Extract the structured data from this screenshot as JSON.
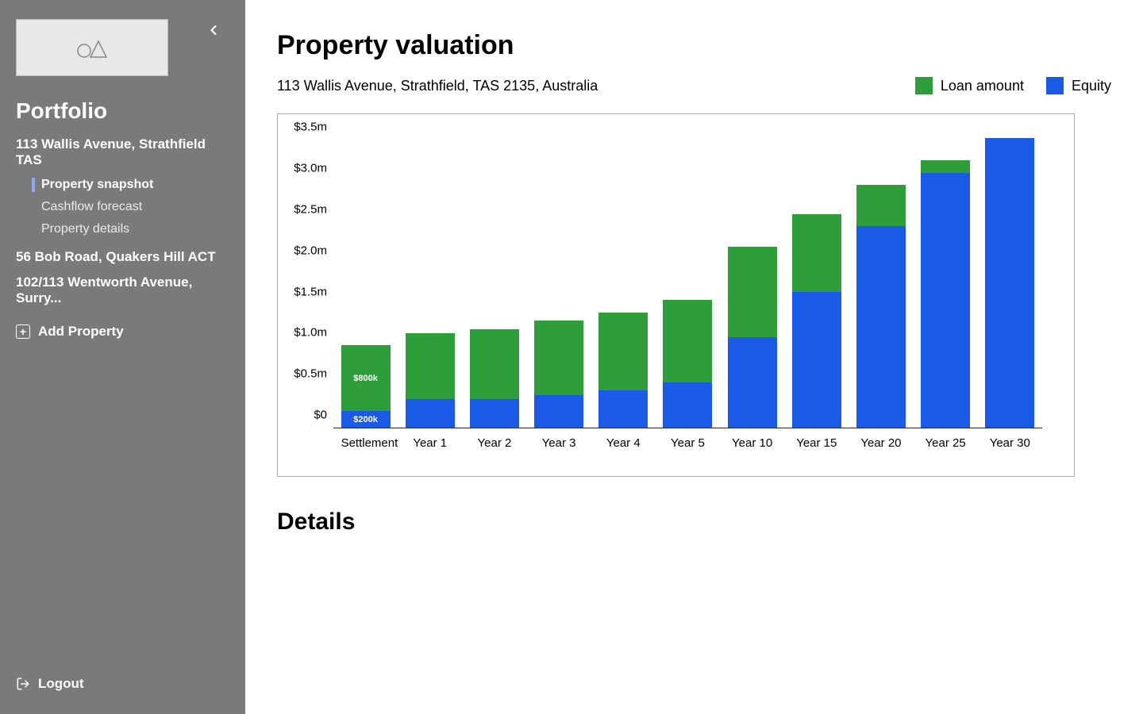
{
  "sidebar": {
    "section_title": "Portfolio",
    "properties": [
      {
        "label": "113 Wallis Avenue, Strathfield TAS"
      },
      {
        "label": "56 Bob Road, Quakers Hill ACT"
      },
      {
        "label": "102/113 Wentworth Avenue, Surry..."
      }
    ],
    "subitems": [
      {
        "label": "Property snapshot",
        "active": true
      },
      {
        "label": "Cashflow forecast",
        "active": false
      },
      {
        "label": "Property details",
        "active": false
      }
    ],
    "add_property": "Add Property",
    "logout": "Logout"
  },
  "main": {
    "title": "Property valuation",
    "address": "113 Wallis Avenue, Strathfield, TAS 2135, Australia",
    "legend": {
      "loan": "Loan amount",
      "equity": "Equity"
    },
    "details_title": "Details",
    "bar_annotations": {
      "loan0": "$800k",
      "equity0": "$200k"
    }
  },
  "chart_data": {
    "type": "bar",
    "stacked": true,
    "title": "Property valuation",
    "xlabel": "",
    "ylabel": "",
    "ylim": [
      0,
      3.55
    ],
    "y_ticks": [
      {
        "v": 0,
        "label": "$0"
      },
      {
        "v": 0.5,
        "label": "$0.5m"
      },
      {
        "v": 1.0,
        "label": "$1.0m"
      },
      {
        "v": 1.5,
        "label": "$1.5m"
      },
      {
        "v": 2.0,
        "label": "$2.0m"
      },
      {
        "v": 2.5,
        "label": "$2.5m"
      },
      {
        "v": 3.0,
        "label": "$3.0m"
      },
      {
        "v": 3.5,
        "label": "$3.5m"
      }
    ],
    "categories": [
      "Settlement",
      "Year 1",
      "Year 2",
      "Year 3",
      "Year 4",
      "Year 5",
      "Year 10",
      "Year 15",
      "Year 20",
      "Year 25",
      "Year 30"
    ],
    "series": [
      {
        "name": "Equity",
        "color": "#1b5ae6",
        "values": [
          0.2,
          0.35,
          0.35,
          0.4,
          0.45,
          0.55,
          1.1,
          1.65,
          2.45,
          3.1,
          3.55
        ]
      },
      {
        "name": "Loan amount",
        "color": "#2e9e3b",
        "values": [
          0.8,
          0.8,
          0.85,
          0.9,
          0.95,
          1.0,
          1.1,
          0.95,
          0.5,
          0.15,
          0.0
        ]
      }
    ],
    "value_unit": "million AUD"
  }
}
